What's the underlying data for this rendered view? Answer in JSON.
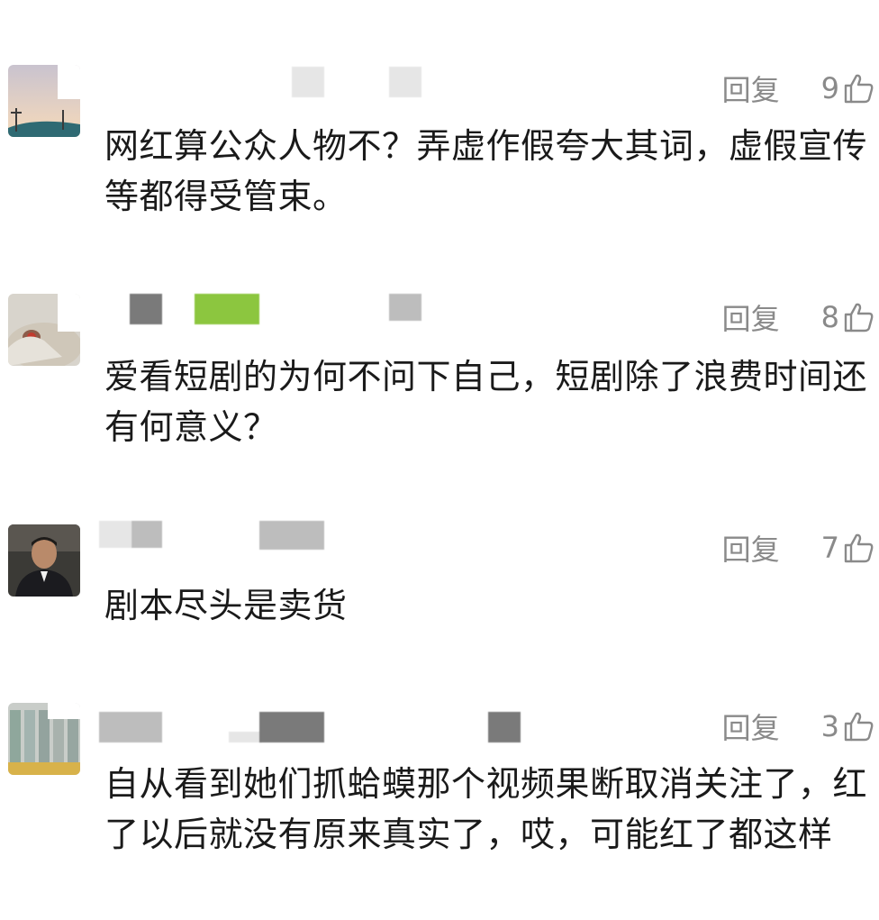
{
  "comments": [
    {
      "reply_label": "回复",
      "likes": "9",
      "text": "网红算公众人物不？弄虚作假夸大其词，虚假宣传等都得受管束。"
    },
    {
      "reply_label": "回复",
      "likes": "8",
      "text": "爱看短剧的为何不问下自己，短剧除了浪费时间还有何意义？"
    },
    {
      "reply_label": "回复",
      "likes": "7",
      "text": "剧本尽头是卖货"
    },
    {
      "reply_label": "回复",
      "likes": "3",
      "text": "自从看到她们抓蛤蟆那个视频果断取消关注了，红了以后就没有原来真实了，哎，可能红了都这样"
    }
  ],
  "icons": {
    "like": "thumbs-up-icon"
  },
  "colors": {
    "secondary_text": "#8a8a8a",
    "body_text": "#1a1a1a",
    "background": "#ffffff"
  }
}
